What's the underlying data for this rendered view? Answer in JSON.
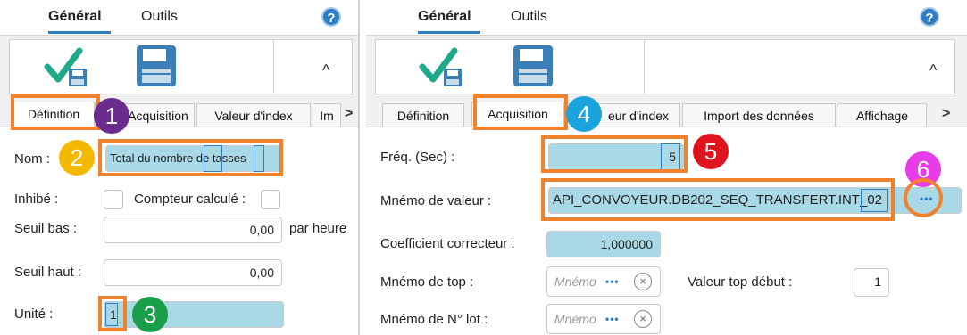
{
  "left": {
    "tabs": {
      "general": "Général",
      "outils": "Outils"
    },
    "help": "?",
    "collapse": "^",
    "subtabs": [
      "Définition",
      "Acquisition",
      "Valeur d'index",
      "Im"
    ],
    "scroll_arrow": ">",
    "form": {
      "nom_label": "Nom :",
      "nom_value_1": "Total du nombre ",
      "nom_value_2": "de",
      "nom_value_3": " tasse",
      "nom_value_4": "s",
      "inhibe_label": "Inhibé :",
      "compteur_label": "Compteur calculé :",
      "seuil_bas_label": "Seuil bas :",
      "seuil_bas_value": "0,00",
      "par_heure": "par heure",
      "seuil_haut_label": "Seuil haut :",
      "seuil_haut_value": "0,00",
      "unite_label": "Unité :",
      "unite_value": "1"
    },
    "badges": [
      "1",
      "2",
      "3"
    ]
  },
  "right": {
    "tabs": {
      "general": "Général",
      "outils": "Outils"
    },
    "help": "?",
    "collapse": "^",
    "subtabs": [
      "Définition",
      "Acquisition",
      "eur d'index",
      "Import des données",
      "Affichage"
    ],
    "scroll_arrow": ">",
    "form": {
      "freq_label": "Fréq. (Sec) :",
      "freq_value": "5",
      "mnemo_valeur_label": "Mnémo de valeur :",
      "mnemo_valeur_value_1": "API_CONVOYEUR.DB202_SEQ_TRANSFERT.INT",
      "mnemo_valeur_value_2": "_02",
      "browse": "•••",
      "coef_label": "Coefficient correcteur :",
      "coef_value": "1,000000",
      "mnemo_top_label": "Mnémo de top :",
      "mnemo_placeholder": "Mnémo",
      "valeur_top_label": "Valeur top début :",
      "valeur_top_value": "1",
      "mnemo_lot_label": "Mnémo de N° lot :",
      "clear": "×"
    },
    "badges": [
      "4",
      "5",
      "6"
    ]
  },
  "colors": {
    "highlight": "#f0822e",
    "badge1": "#6a2d8f",
    "badge2": "#f5b800",
    "badge3": "#1a9e4a",
    "badge4": "#1ba3dc",
    "badge5": "#e0141e",
    "badge6": "#e83ce8",
    "accent": "#2e7cc4",
    "field_blue": "#a9d8e6"
  }
}
